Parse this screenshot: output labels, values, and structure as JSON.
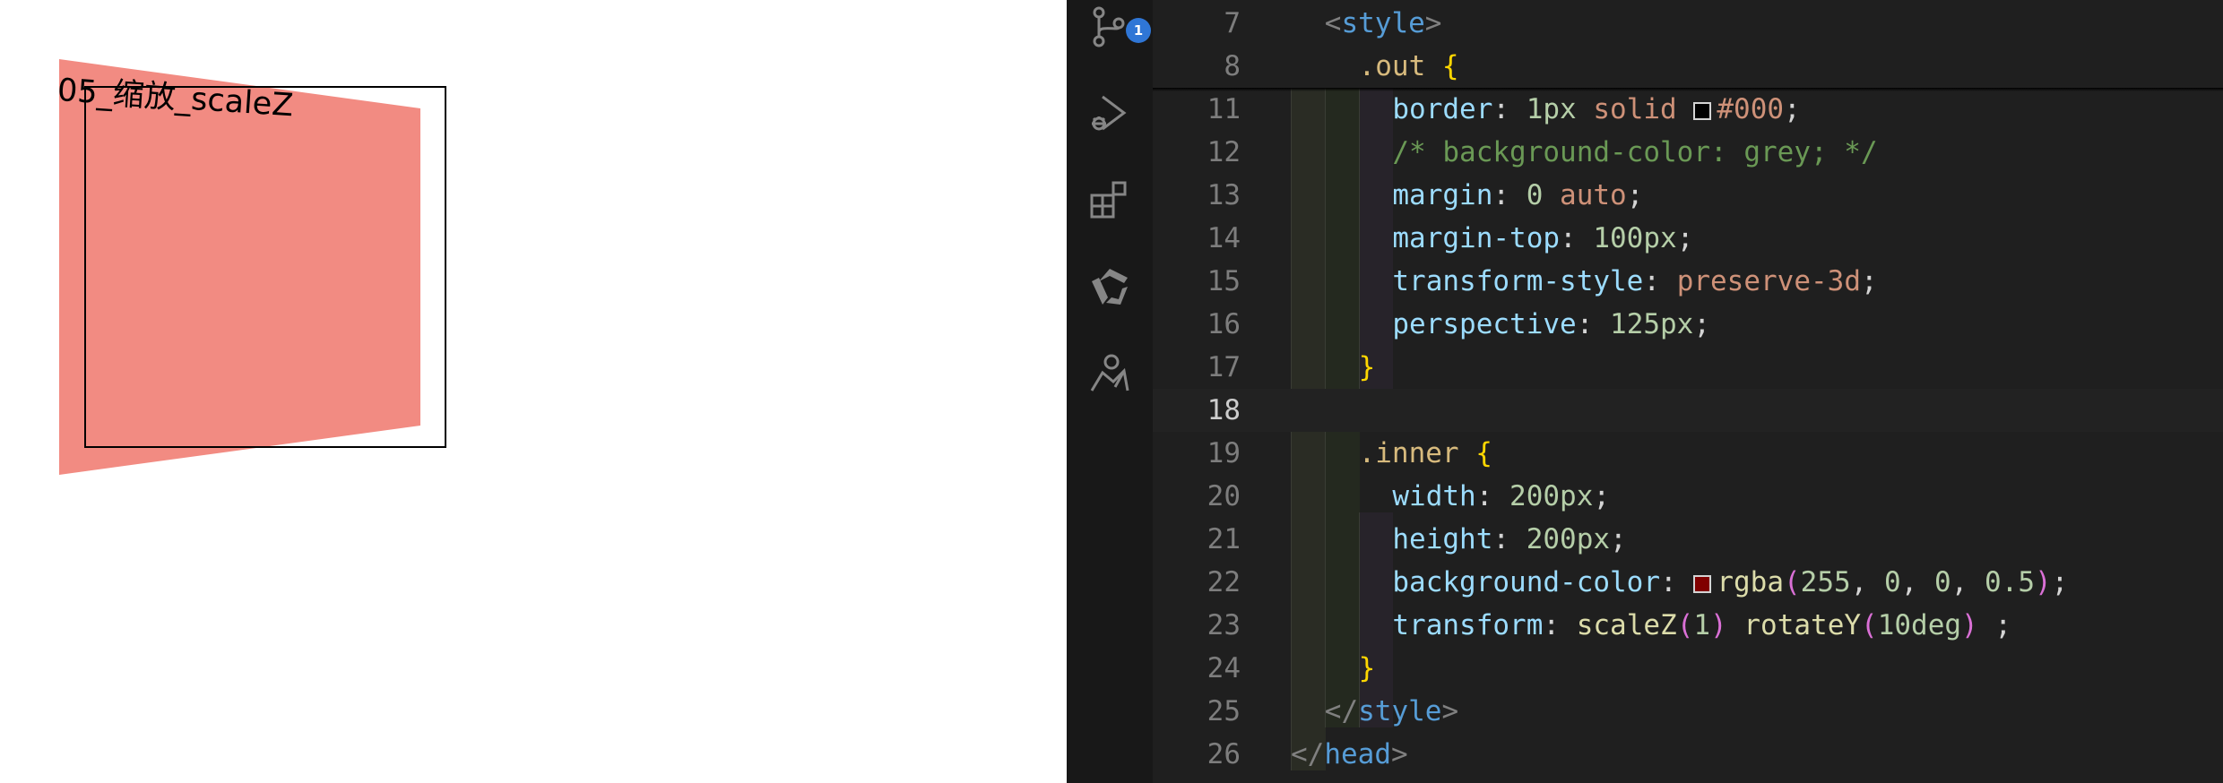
{
  "preview": {
    "title": "05_缩放_scaleZ",
    "inner_fill": "#f28b82",
    "outer_border": "#000000"
  },
  "activity_bar": {
    "scm_badge": "1",
    "icons": [
      "source-control-icon",
      "run-debug-icon",
      "extensions-icon",
      "remote-icon",
      "accounts-icon"
    ]
  },
  "editor": {
    "sticky_lines": [
      {
        "number": "7",
        "tokens": [
          [
            "punct",
            "<"
          ],
          [
            "tag",
            "style"
          ],
          [
            "punct",
            ">"
          ]
        ],
        "indent": 2
      },
      {
        "number": "8",
        "tokens": [
          [
            "sel",
            ".out"
          ],
          [
            "plain",
            " "
          ],
          [
            "brace",
            "{"
          ]
        ],
        "indent": 4
      }
    ],
    "lines": [
      {
        "number": "11",
        "indent": 6,
        "tokens": [
          [
            "prop",
            "border"
          ],
          [
            "plain",
            ": "
          ],
          [
            "num",
            "1px"
          ],
          [
            "plain",
            " "
          ],
          [
            "val",
            "solid"
          ],
          [
            "plain",
            " "
          ],
          [
            "swatch",
            "#000000"
          ],
          [
            "val",
            "#000"
          ],
          [
            "plain",
            ";"
          ]
        ]
      },
      {
        "number": "12",
        "indent": 6,
        "tokens": [
          [
            "comment",
            "/* background-color: grey; */"
          ]
        ]
      },
      {
        "number": "13",
        "indent": 6,
        "tokens": [
          [
            "prop",
            "margin"
          ],
          [
            "plain",
            ": "
          ],
          [
            "num",
            "0"
          ],
          [
            "plain",
            " "
          ],
          [
            "val",
            "auto"
          ],
          [
            "plain",
            ";"
          ]
        ]
      },
      {
        "number": "14",
        "indent": 6,
        "tokens": [
          [
            "prop",
            "margin-top"
          ],
          [
            "plain",
            ": "
          ],
          [
            "num",
            "100px"
          ],
          [
            "plain",
            ";"
          ]
        ]
      },
      {
        "number": "15",
        "indent": 6,
        "tokens": [
          [
            "prop",
            "transform-style"
          ],
          [
            "plain",
            ": "
          ],
          [
            "val",
            "preserve-3d"
          ],
          [
            "plain",
            ";"
          ]
        ]
      },
      {
        "number": "16",
        "indent": 6,
        "tokens": [
          [
            "prop",
            "perspective"
          ],
          [
            "plain",
            ": "
          ],
          [
            "num",
            "125px"
          ],
          [
            "plain",
            ";"
          ]
        ]
      },
      {
        "number": "17",
        "indent": 4,
        "tokens": [
          [
            "brace",
            "}"
          ]
        ]
      },
      {
        "number": "18",
        "indent": 0,
        "tokens": [],
        "current": true
      },
      {
        "number": "19",
        "indent": 4,
        "tokens": [
          [
            "sel",
            ".inner"
          ],
          [
            "plain",
            " "
          ],
          [
            "brace",
            "{"
          ]
        ]
      },
      {
        "number": "20",
        "indent": 6,
        "tokens": [
          [
            "prop",
            "width"
          ],
          [
            "plain",
            ": "
          ],
          [
            "num",
            "200px"
          ],
          [
            "plain",
            ";"
          ]
        ]
      },
      {
        "number": "21",
        "indent": 6,
        "tokens": [
          [
            "prop",
            "height"
          ],
          [
            "plain",
            ": "
          ],
          [
            "num",
            "200px"
          ],
          [
            "plain",
            ";"
          ]
        ]
      },
      {
        "number": "22",
        "indent": 6,
        "tokens": [
          [
            "prop",
            "background-color"
          ],
          [
            "plain",
            ": "
          ],
          [
            "swatch",
            "#800000"
          ],
          [
            "fn",
            "rgba"
          ],
          [
            "paren",
            "("
          ],
          [
            "num",
            "255"
          ],
          [
            "plain",
            ", "
          ],
          [
            "num",
            "0"
          ],
          [
            "plain",
            ", "
          ],
          [
            "num",
            "0"
          ],
          [
            "plain",
            ", "
          ],
          [
            "num",
            "0.5"
          ],
          [
            "paren",
            ")"
          ],
          [
            "plain",
            ";"
          ]
        ]
      },
      {
        "number": "23",
        "indent": 6,
        "tokens": [
          [
            "prop",
            "transform"
          ],
          [
            "plain",
            ": "
          ],
          [
            "fn",
            "scaleZ"
          ],
          [
            "paren",
            "("
          ],
          [
            "num",
            "1"
          ],
          [
            "paren",
            ")"
          ],
          [
            "plain",
            " "
          ],
          [
            "fn",
            "rotateY"
          ],
          [
            "paren",
            "("
          ],
          [
            "num",
            "10deg"
          ],
          [
            "paren",
            ")"
          ],
          [
            "plain",
            " ;"
          ]
        ]
      },
      {
        "number": "24",
        "indent": 4,
        "tokens": [
          [
            "brace",
            "}"
          ]
        ]
      },
      {
        "number": "25",
        "indent": 2,
        "tokens": [
          [
            "punct",
            "</"
          ],
          [
            "tag",
            "style"
          ],
          [
            "punct",
            ">"
          ]
        ]
      },
      {
        "number": "26",
        "indent": 0,
        "tokens": [
          [
            "punct",
            "</"
          ],
          [
            "tag",
            "head"
          ],
          [
            "punct",
            ">"
          ]
        ]
      }
    ]
  }
}
